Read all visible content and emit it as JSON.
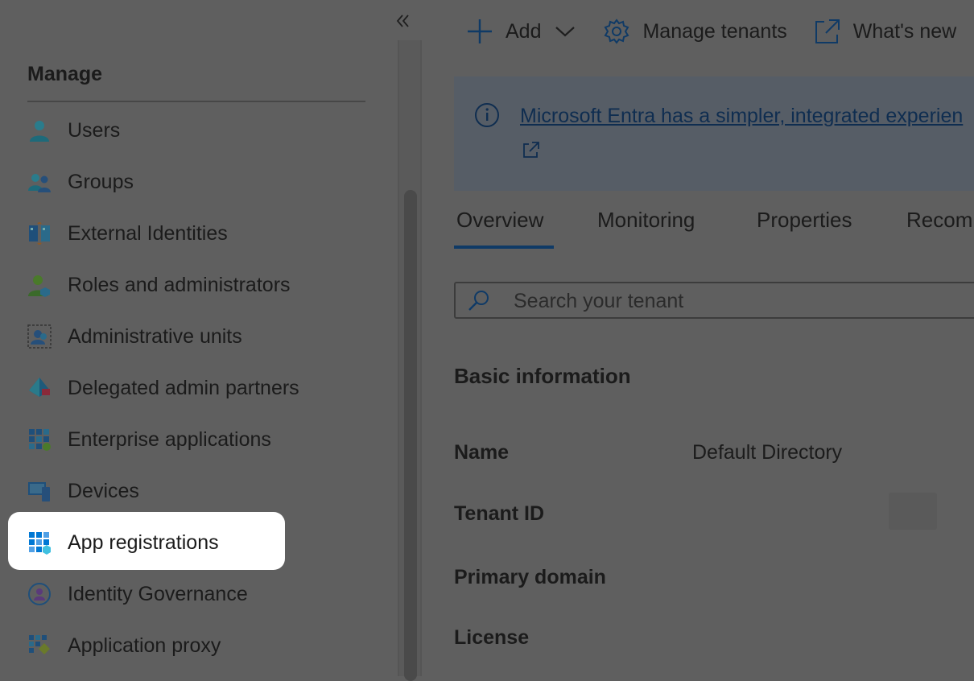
{
  "sidebar": {
    "collapse_icon": "double-chevron-left-icon",
    "section_title": "Manage",
    "items": [
      {
        "label": "Users",
        "icon": "users-icon"
      },
      {
        "label": "Groups",
        "icon": "groups-icon"
      },
      {
        "label": "External Identities",
        "icon": "external-identities-icon"
      },
      {
        "label": "Roles and administrators",
        "icon": "roles-icon"
      },
      {
        "label": "Administrative units",
        "icon": "administrative-units-icon"
      },
      {
        "label": "Delegated admin partners",
        "icon": "delegated-admin-icon"
      },
      {
        "label": "Enterprise applications",
        "icon": "enterprise-apps-icon"
      },
      {
        "label": "Devices",
        "icon": "devices-icon"
      },
      {
        "label": "App registrations",
        "icon": "app-registrations-icon",
        "selected": true
      },
      {
        "label": "Identity Governance",
        "icon": "identity-governance-icon"
      },
      {
        "label": "Application proxy",
        "icon": "application-proxy-icon"
      }
    ]
  },
  "toolbar": {
    "add_label": "Add",
    "manage_tenants_label": "Manage tenants",
    "whats_new_label": "What's new"
  },
  "banner": {
    "link_text": "Microsoft Entra has a simpler, integrated experien"
  },
  "tabs": [
    {
      "label": "Overview",
      "active": true
    },
    {
      "label": "Monitoring"
    },
    {
      "label": "Properties"
    },
    {
      "label": "Recom"
    }
  ],
  "search": {
    "placeholder": "Search your tenant"
  },
  "basic_info": {
    "title": "Basic information",
    "rows": [
      {
        "label": "Name",
        "value": "Default Directory"
      },
      {
        "label": "Tenant ID",
        "value": ""
      },
      {
        "label": "Primary domain",
        "value": ""
      },
      {
        "label": "License",
        "value": ""
      }
    ]
  },
  "colors": {
    "overlay_gray": "#5f5f5f",
    "highlight": "#ffffff",
    "accent_blue": "#0f3a66"
  }
}
